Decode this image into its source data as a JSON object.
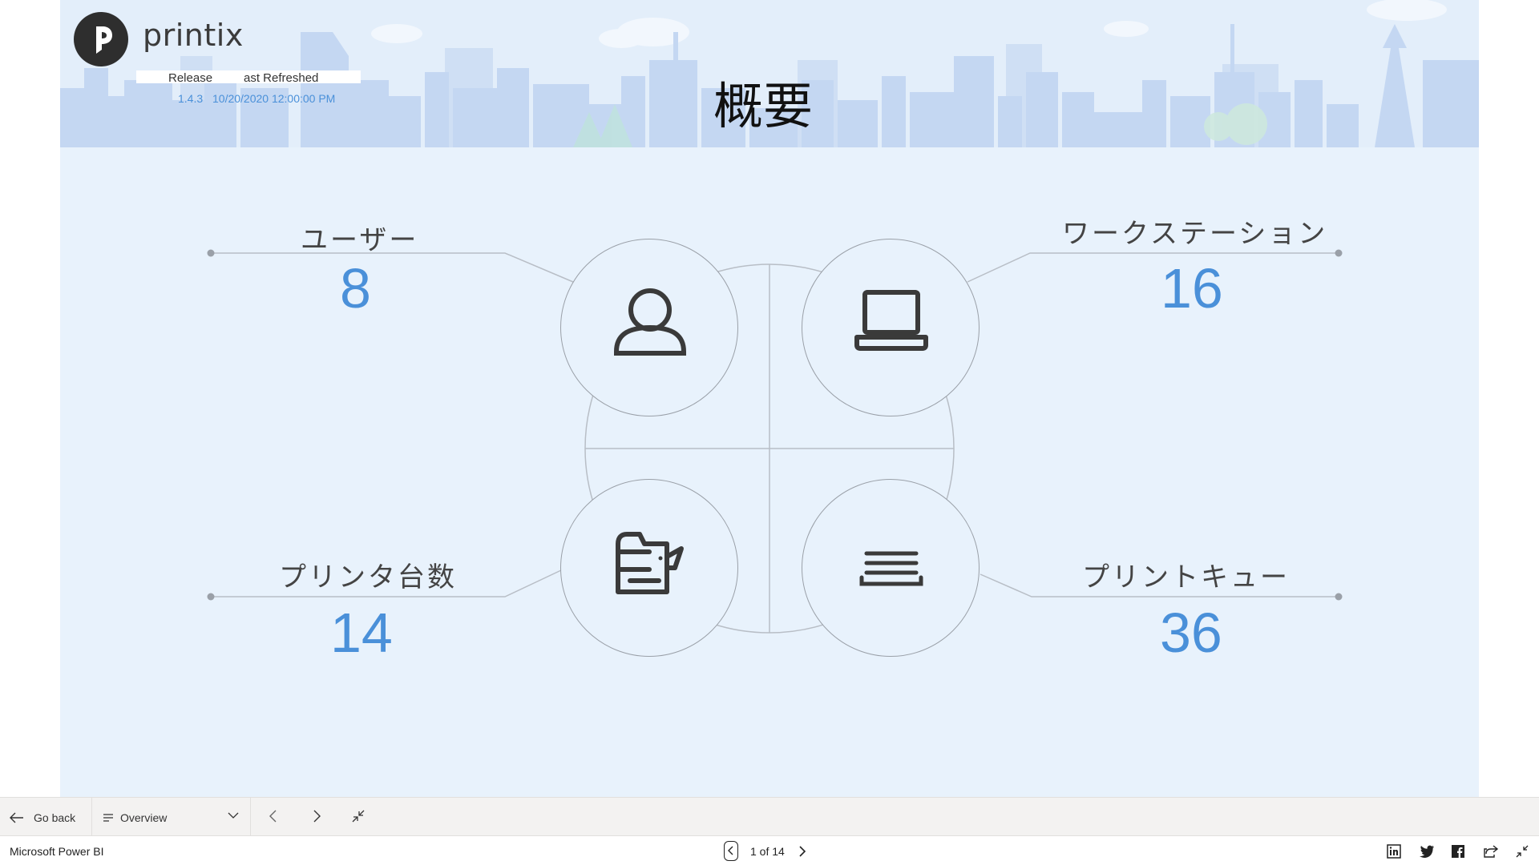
{
  "header": {
    "logo_text": "printix",
    "release_label": "Release",
    "refreshed_label": "ast Refreshed",
    "release_version": "1.4.3",
    "refresh_date": "10/20/2020 12:00:00 PM",
    "page_title": "概要"
  },
  "metrics": {
    "users": {
      "label": "ユーザー",
      "value": "8",
      "icon": "user-icon"
    },
    "workstations": {
      "label": "ワークステーション",
      "value": "16",
      "icon": "laptop-icon"
    },
    "printers": {
      "label": "プリンタ台数",
      "value": "14",
      "icon": "printer-icon"
    },
    "print_queues": {
      "label": "プリントキュー",
      "value": "36",
      "icon": "queue-icon"
    }
  },
  "colors": {
    "accent": "#4a90d9",
    "background": "#e8f2fc",
    "banner": "#c9daf3"
  },
  "toolbar": {
    "go_back": "Go back",
    "page_select": "Overview"
  },
  "statusbar": {
    "app_name": "Microsoft Power BI",
    "pager": "1 of 14"
  }
}
